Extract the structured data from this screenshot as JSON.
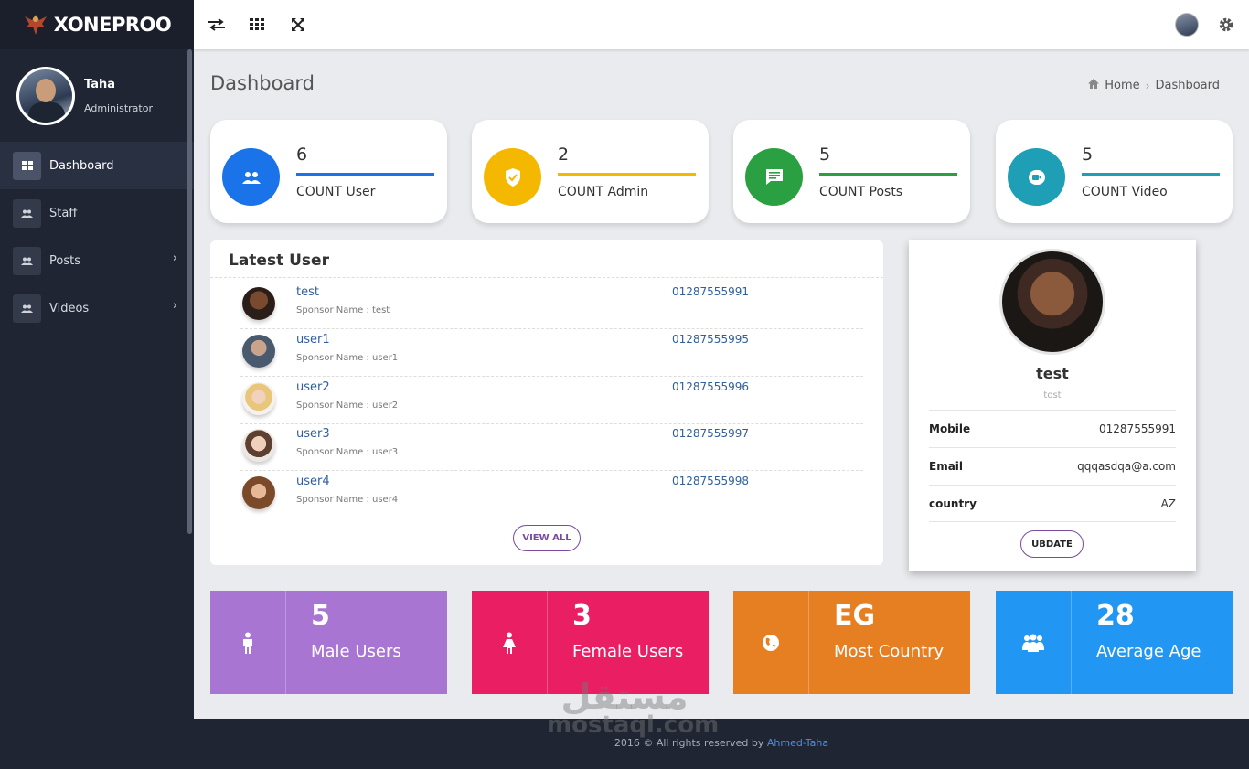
{
  "brand": {
    "name": "XONEPROO"
  },
  "profile": {
    "name": "Taha",
    "role": "Administrator"
  },
  "sidebar": {
    "items": [
      {
        "label": "Dashboard",
        "active": true,
        "has_arrow": false
      },
      {
        "label": "Staff",
        "active": false,
        "has_arrow": false
      },
      {
        "label": "Posts",
        "active": false,
        "has_arrow": true
      },
      {
        "label": "Videos",
        "active": false,
        "has_arrow": true
      }
    ]
  },
  "header": {
    "title": "Dashboard",
    "breadcrumb": {
      "home": "Home",
      "current": "Dashboard"
    }
  },
  "stats": [
    {
      "value": "6",
      "label": "COUNT User",
      "color": "#1a73e8",
      "icon": "users-icon"
    },
    {
      "value": "2",
      "label": "COUNT Admin",
      "color": "#f5b800",
      "icon": "shield-check-icon"
    },
    {
      "value": "5",
      "label": "COUNT Posts",
      "color": "#2aa043",
      "icon": "chat-icon"
    },
    {
      "value": "5",
      "label": "COUNT Video",
      "color": "#1e9fb5",
      "icon": "video-icon"
    }
  ],
  "latest": {
    "title": "Latest User",
    "view_all": "VIEW ALL",
    "users": [
      {
        "name": "test",
        "sponsor": "Sponsor Name : test",
        "phone": "01287555991"
      },
      {
        "name": "user1",
        "sponsor": "Sponsor Name : user1",
        "phone": "01287555995"
      },
      {
        "name": "user2",
        "sponsor": "Sponsor Name : user2",
        "phone": "01287555996"
      },
      {
        "name": "user3",
        "sponsor": "Sponsor Name : user3",
        "phone": "01287555997"
      },
      {
        "name": "user4",
        "sponsor": "Sponsor Name : user4",
        "phone": "01287555998"
      }
    ]
  },
  "profile_card": {
    "name": "test",
    "subtitle": "tost",
    "rows": [
      {
        "key": "Mobile",
        "value": "01287555991"
      },
      {
        "key": "Email",
        "value": "qqqasdqa@a.com"
      },
      {
        "key": "country",
        "value": "AZ"
      }
    ],
    "button": "UBDATE"
  },
  "summary": [
    {
      "value": "5",
      "label": "Male Users",
      "color": "#a876d2",
      "icon": "male-icon"
    },
    {
      "value": "3",
      "label": "Female Users",
      "color": "#e91e63",
      "icon": "female-icon"
    },
    {
      "value": "EG",
      "label": "Most Country",
      "color": "#e67e22",
      "icon": "globe-icon"
    },
    {
      "value": "28",
      "label": "Average Age",
      "color": "#2196f3",
      "icon": "group-icon"
    }
  ],
  "footer": {
    "text": "2016 © All rights reserved by ",
    "author": "Ahmed-Taha"
  },
  "watermark": {
    "arabic": "مستقل",
    "latin": "mostaql.com"
  }
}
